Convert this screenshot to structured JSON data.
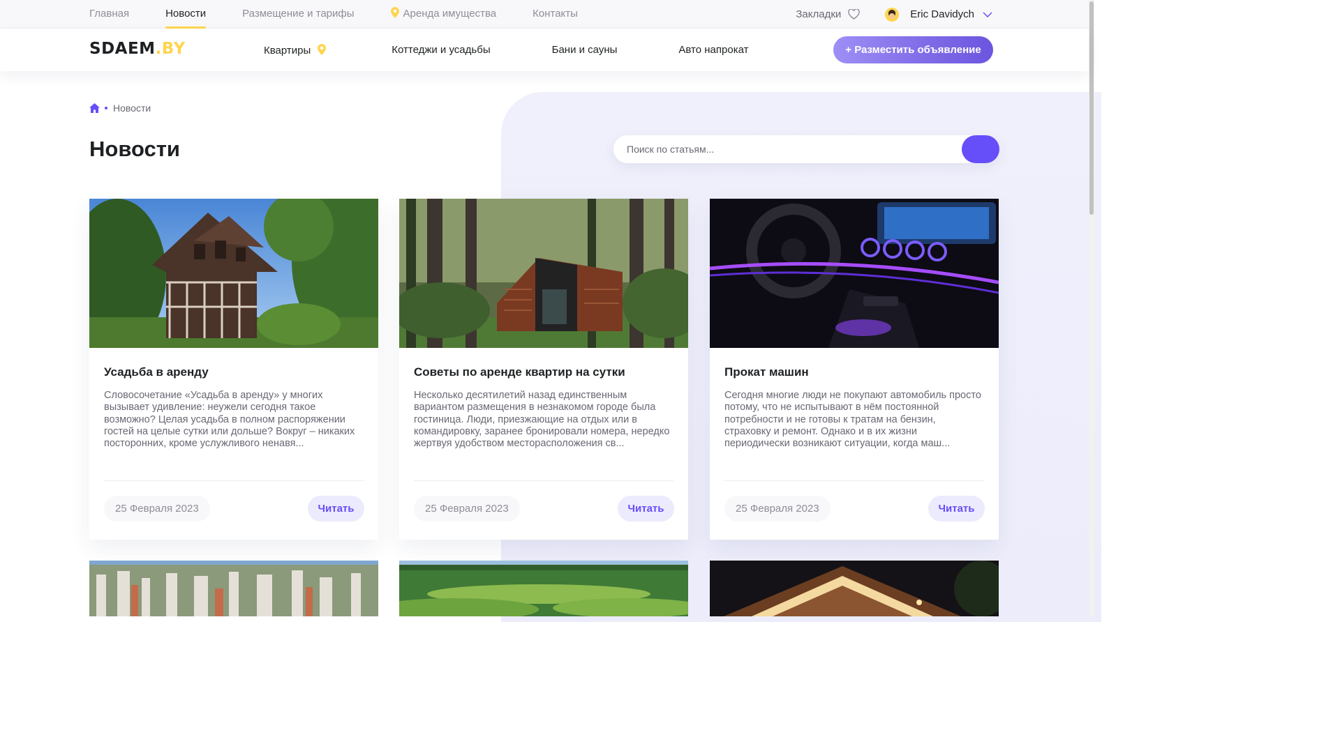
{
  "topbar": {
    "nav": [
      "Главная",
      "Новости",
      "Размещение и тарифы",
      "Аренда имущества",
      "Контакты"
    ],
    "active_nav": "Новости",
    "bookmarks_label": "Закладки",
    "user_name": "Eric Davidych"
  },
  "header": {
    "logo_main": "SDAEM",
    "logo_suffix": ".BY",
    "nav": [
      "Квартиры",
      "Коттеджи и усадьбы",
      "Бани и сауны",
      "Авто напрокат"
    ],
    "cta_label": "+ Разместить объявление"
  },
  "breadcrumb": {
    "current": "Новости"
  },
  "page": {
    "title": "Новости"
  },
  "search": {
    "placeholder": "Поиск по статьям..."
  },
  "articles": [
    {
      "title": "Усадьба в аренду",
      "excerpt": "Словосочетание «Усадьба в аренду» у многих вызывает удивление: неужели сегодня такое возможно? Целая усадьба в полном распоряжении гостей на целые сутки или дольше? Вокруг – никаких посторонних, кроме услужливого ненавя...",
      "date": "25 Февраля 2023",
      "read_label": "Читать"
    },
    {
      "title": "Советы по аренде квартир на сутки",
      "excerpt": "Несколько десятилетий назад единственным вариантом размещения в незнакомом городе была гостиница. Люди, приезжающие на отдых или в командировку, заранее бронировали номера, нередко жертвуя удобством месторасположения св...",
      "date": "25 Февраля 2023",
      "read_label": "Читать"
    },
    {
      "title": "Прокат машин",
      "excerpt": "Сегодня многие люди не покупают автомобиль просто потому, что не испытывают в нём постоянной потребности и не готовы к тратам на бензин, страховку и ремонт. Однако и в их жизни периодически возникают ситуации, когда маш...",
      "date": "25 Февраля 2023",
      "read_label": "Читать"
    }
  ],
  "colors": {
    "accent": "#664ef9",
    "brand_yellow": "#ffd54f",
    "text_dark": "#1e2123",
    "text_muted": "#686874"
  }
}
